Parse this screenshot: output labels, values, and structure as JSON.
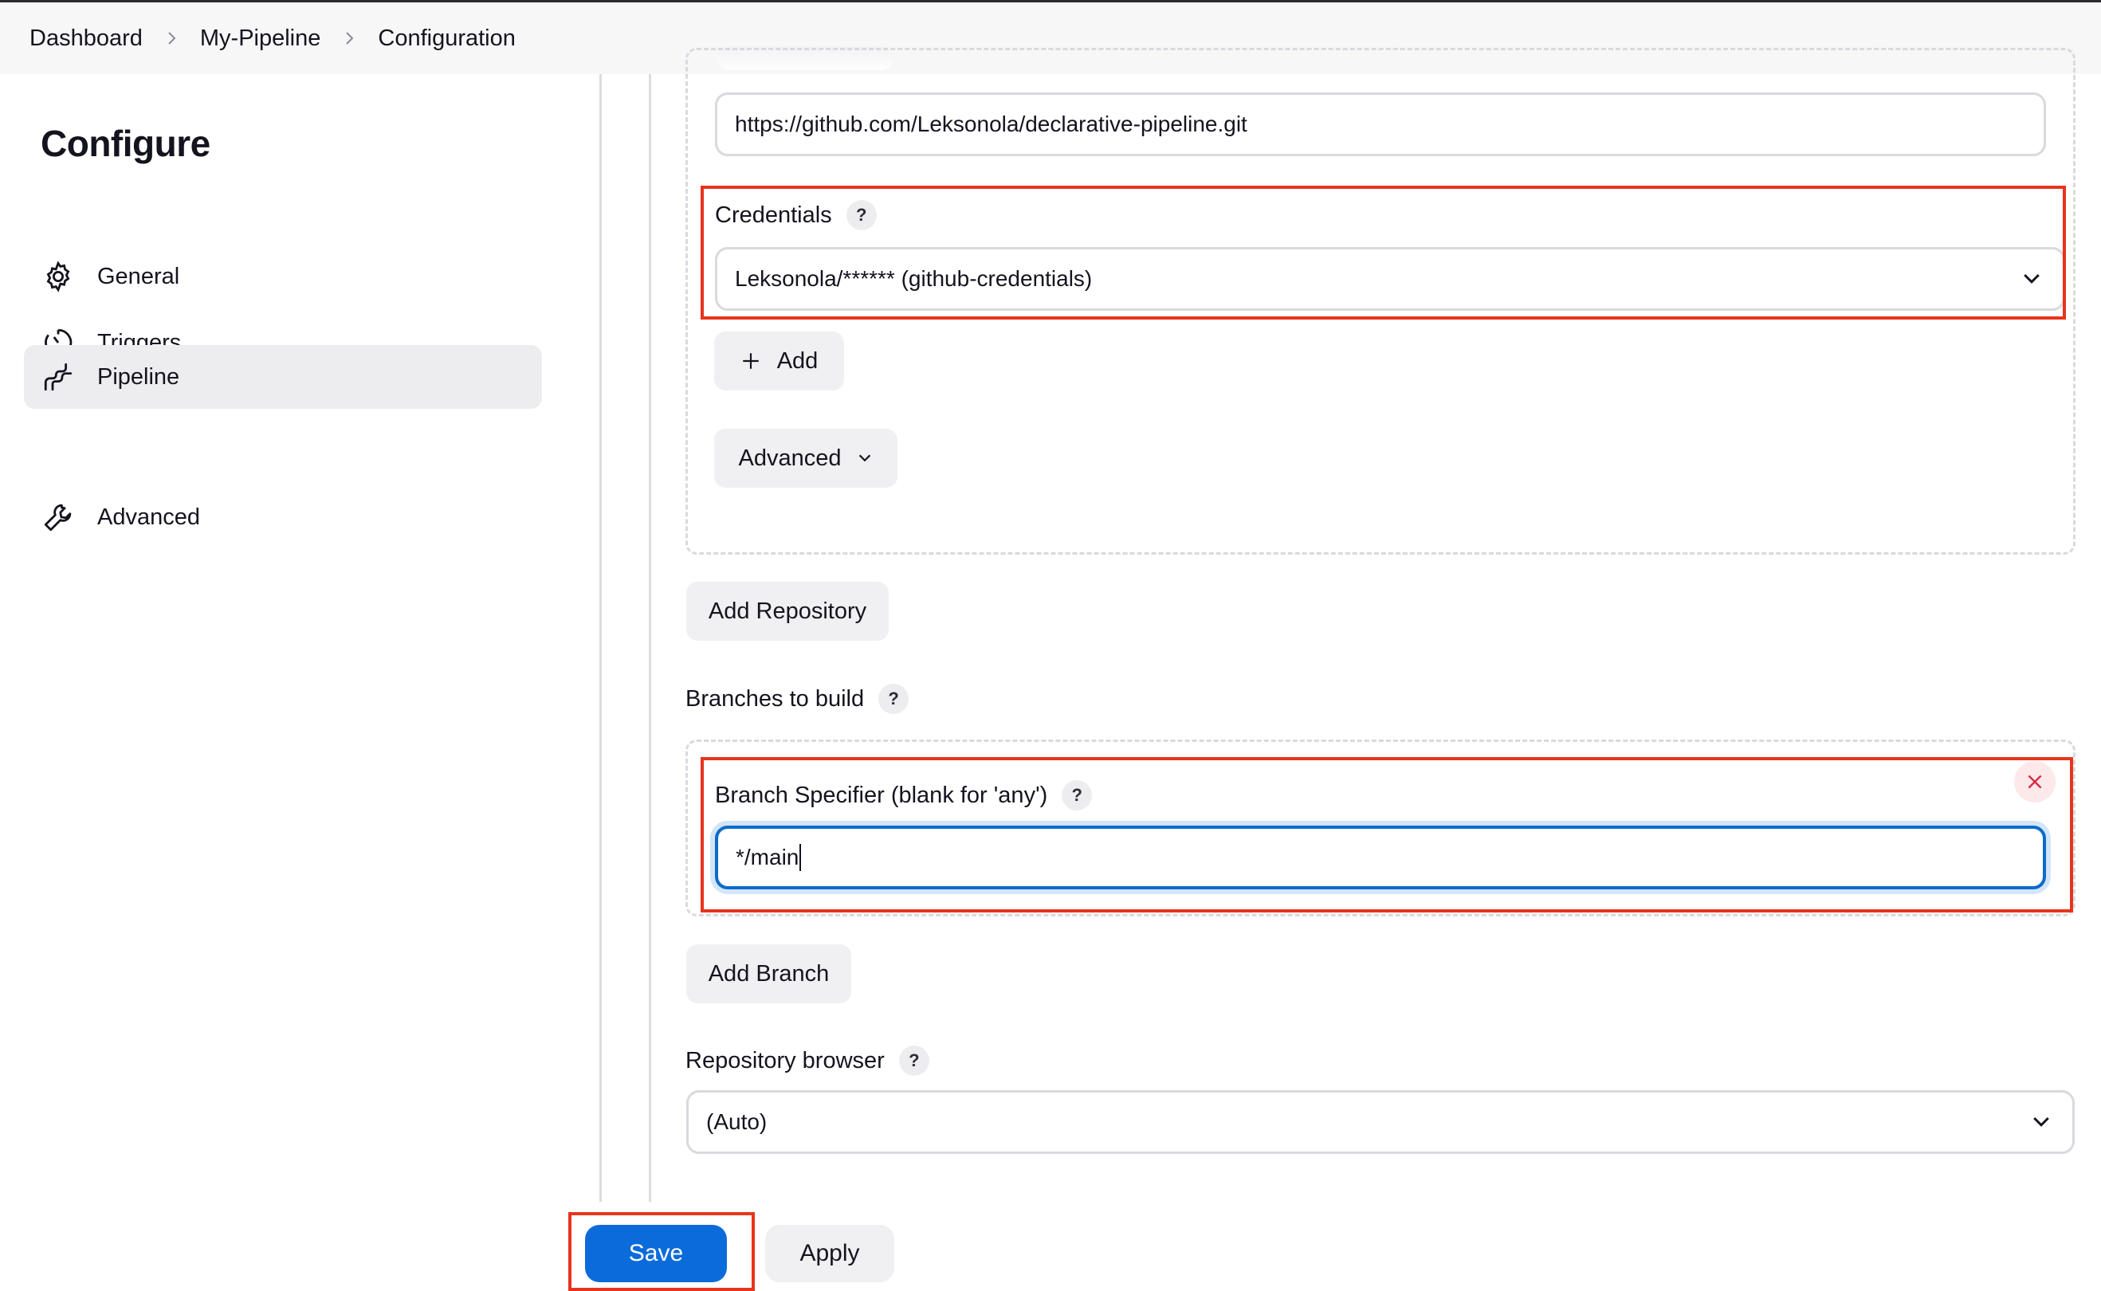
{
  "breadcrumb": {
    "items": [
      "Dashboard",
      "My-Pipeline",
      "Configuration"
    ]
  },
  "sidebar": {
    "title": "Configure",
    "items": [
      {
        "label": "General",
        "icon": "gear-icon"
      },
      {
        "label": "Triggers",
        "icon": "clock-icon"
      },
      {
        "label": "Pipeline",
        "icon": "pipeline-icon",
        "active": true
      },
      {
        "label": "Advanced",
        "icon": "wrench-icon"
      }
    ]
  },
  "repository": {
    "url_value": "https://github.com/Leksonola/declarative-pipeline.git",
    "credentials_label": "Credentials",
    "credentials_value": "Leksonola/****** (github-credentials)",
    "add_label": "Add",
    "advanced_label": "Advanced",
    "add_repository_label": "Add Repository"
  },
  "branches": {
    "label": "Branches to build",
    "specifier_label": "Branch Specifier (blank for 'any')",
    "specifier_value": "*/main",
    "add_branch_label": "Add Branch"
  },
  "repo_browser": {
    "label": "Repository browser",
    "value": "(Auto)"
  },
  "help_glyph": "?",
  "footer": {
    "save_label": "Save",
    "apply_label": "Apply"
  },
  "colors": {
    "primary": "#0b6bdb",
    "highlight": "#e8341c",
    "focus": "#0b6bcb"
  }
}
